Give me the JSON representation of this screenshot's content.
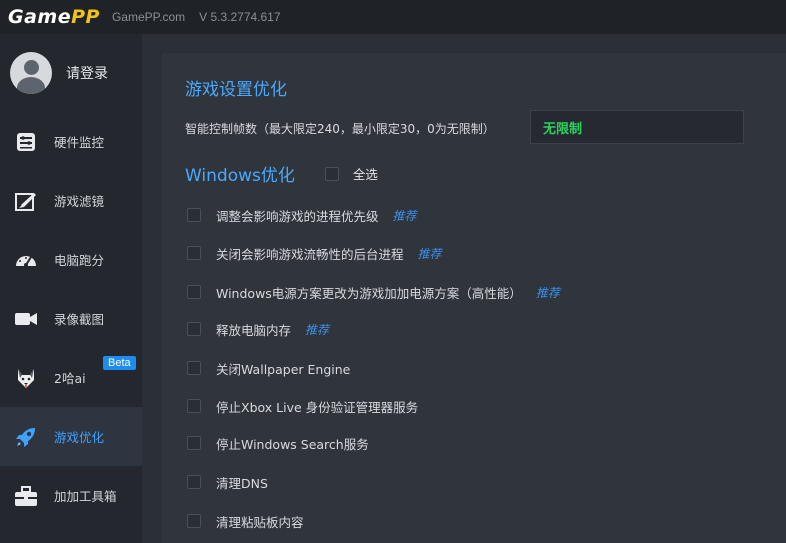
{
  "titlebar": {
    "logo_part1": "Game",
    "logo_part2": "PP",
    "site": "GamePP.com",
    "version": "V 5.3.2774.617"
  },
  "sidebar": {
    "login_label": "请登录",
    "items": [
      {
        "label": "硬件监控",
        "icon": "hardware-monitor-icon"
      },
      {
        "label": "游戏滤镜",
        "icon": "filter-brush-icon"
      },
      {
        "label": "电脑跑分",
        "icon": "speedometer-icon"
      },
      {
        "label": "录像截图",
        "icon": "video-camera-icon"
      },
      {
        "label": "2哈ai",
        "icon": "husky-icon",
        "badge": "Beta"
      },
      {
        "label": "游戏优化",
        "icon": "rocket-icon",
        "active": true
      },
      {
        "label": "加加工具箱",
        "icon": "toolbox-icon"
      }
    ]
  },
  "main": {
    "section_title": "游戏设置优化",
    "fps_label": "智能控制帧数（最大限定240，最小限定30，0为无限制）",
    "fps_value": "无限制",
    "windows_title": "Windows优化",
    "select_all": "全选",
    "options": [
      {
        "label": "调整会影响游戏的进程优先级",
        "tag": "推荐"
      },
      {
        "label": "关闭会影响游戏流畅性的后台进程",
        "tag": "推荐"
      },
      {
        "label": "Windows电源方案更改为游戏加加电源方案（高性能）",
        "tag": "推荐"
      },
      {
        "label": "释放电脑内存",
        "tag": "推荐"
      },
      {
        "label": "关闭Wallpaper Engine",
        "tag": ""
      },
      {
        "label": "停止Xbox Live 身份验证管理器服务",
        "tag": ""
      },
      {
        "label": "停止Windows Search服务",
        "tag": ""
      },
      {
        "label": "清理DNS",
        "tag": ""
      },
      {
        "label": "清理粘贴板内容",
        "tag": ""
      }
    ]
  },
  "colors": {
    "accent": "#3fa2ff",
    "fps_value": "#2ad15f",
    "logo_highlight": "#f2c21b"
  }
}
